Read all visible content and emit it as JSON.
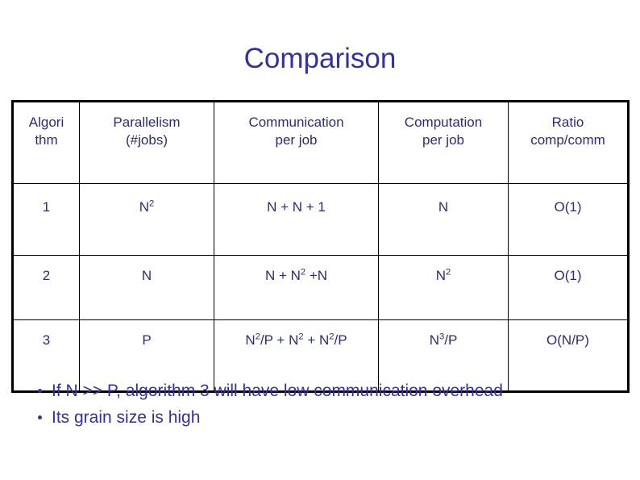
{
  "slide": {
    "title": "Comparison",
    "title_color": "#3432a0",
    "body_text_color": "#2d2b7a",
    "background_color": "#ffffff",
    "border_color": "#000000"
  },
  "table": {
    "headers": [
      "Algori\nthm",
      "Parallelism\n(#jobs)",
      "Communication\nper job",
      "Computation\nper job",
      "Ratio\ncomp/comm"
    ],
    "rows": [
      {
        "algorithm": "1",
        "parallelism": "N2",
        "parallelism_base": "N",
        "parallelism_exp": "2",
        "communication": "N +  N + 1",
        "computation": "N",
        "ratio": "O(1)"
      },
      {
        "algorithm": "2",
        "parallelism": "N",
        "communication": "N + N2 +N",
        "computation": "N2",
        "computation_base": "N",
        "computation_exp": "2",
        "ratio": "O(1)"
      },
      {
        "algorithm": "3",
        "parallelism": "P",
        "communication": "N2/P + N2 + N2/P",
        "computation": "N3/P",
        "computation_base": "N",
        "computation_exp": "3",
        "computation_suffix": "/P",
        "ratio": "O(N/P)"
      }
    ]
  },
  "bullets": [
    "If N >> P, algorithm 3 will have low communication overhead",
    "Its grain size is high"
  ]
}
